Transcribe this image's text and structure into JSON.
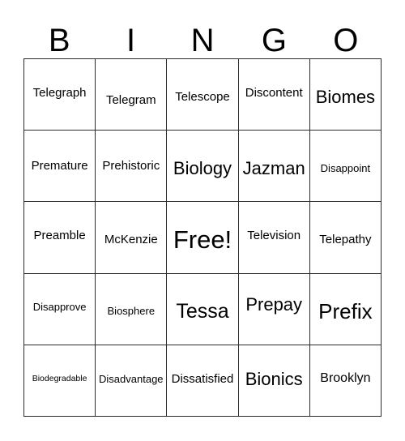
{
  "card": {
    "header_letters": [
      "B",
      "I",
      "N",
      "G",
      "O"
    ],
    "free_space_label": "Free!",
    "rows": [
      [
        {
          "text": "Telegraph",
          "size": "m"
        },
        {
          "text": "Telegram",
          "size": "m"
        },
        {
          "text": "Telescope",
          "size": "m"
        },
        {
          "text": "Discontent",
          "size": "m"
        },
        {
          "text": "Biomes",
          "size": "xl"
        }
      ],
      [
        {
          "text": "Premature",
          "size": "m"
        },
        {
          "text": "Prehistoric",
          "size": "m"
        },
        {
          "text": "Biology",
          "size": "xl"
        },
        {
          "text": "Jazman",
          "size": "xl"
        },
        {
          "text": "Disappoint",
          "size": "s"
        }
      ],
      [
        {
          "text": "Preamble",
          "size": "m"
        },
        {
          "text": "McKenzie",
          "size": "m"
        },
        {
          "text": "Free!",
          "size": "free"
        },
        {
          "text": "Television",
          "size": "m"
        },
        {
          "text": "Telepathy",
          "size": "m"
        }
      ],
      [
        {
          "text": "Disapprove",
          "size": "s"
        },
        {
          "text": "Biosphere",
          "size": "s"
        },
        {
          "text": "Tessa",
          "size": "xxl"
        },
        {
          "text": "Prepay",
          "size": "xl"
        },
        {
          "text": "Prefix",
          "size": "xxxl"
        }
      ],
      [
        {
          "text": "Biodegradable",
          "size": "xs"
        },
        {
          "text": "Disadvantage",
          "size": "s"
        },
        {
          "text": "Dissatisfied",
          "size": "m"
        },
        {
          "text": "Bionics",
          "size": "xl"
        },
        {
          "text": "Brooklyn",
          "size": "l"
        }
      ]
    ]
  },
  "style": {
    "border_color": "#2b2b2b",
    "text_color": "#000000",
    "background_color": "#ffffff"
  }
}
